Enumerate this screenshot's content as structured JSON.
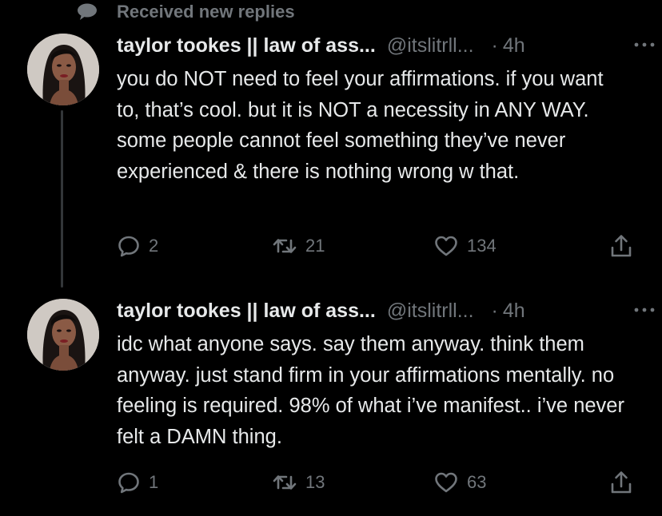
{
  "header": {
    "label": "Received new replies",
    "icon": "speech-bubble-icon"
  },
  "colors": {
    "background": "#000000",
    "primary_text": "#e7e9ea",
    "secondary_text": "#71767b",
    "thread_line": "#333639"
  },
  "tweets": [
    {
      "author_name": "taylor tookes || law of ass...",
      "handle": "@itslitrll...",
      "separator": "·",
      "time": "4h",
      "text": "you do NOT need to feel your affirmations. if you want to, that’s cool. but it is NOT a necessity in ANY WAY. some people cannot feel something they’ve never experienced & there is nothing wrong w that.",
      "replies": "2",
      "retweets": "21",
      "likes": "134"
    },
    {
      "author_name": "taylor tookes || law of ass...",
      "handle": "@itslitrll...",
      "separator": "·",
      "time": "4h",
      "text": "idc what anyone says. say them anyway. think them anyway. just stand firm in your affirmations mentally. no feeling is required. 98% of what i’ve manifest.. i’ve never felt a DAMN thing.",
      "replies": "1",
      "retweets": "13",
      "likes": "63"
    }
  ]
}
